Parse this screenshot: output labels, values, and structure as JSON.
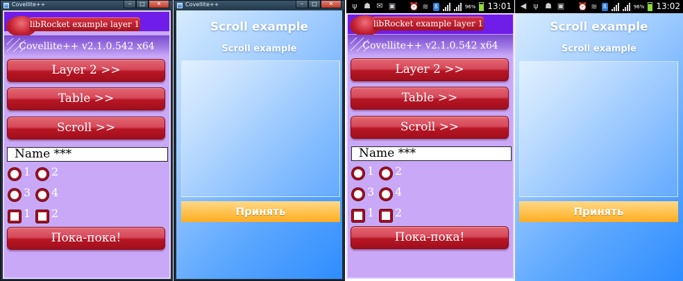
{
  "windows": {
    "title": "Covellite++",
    "controls": {
      "minimize": "–",
      "maximize": "□",
      "close": "✕"
    }
  },
  "android": {
    "screen1": {
      "time": "13:01",
      "battery": "96%"
    },
    "screen2": {
      "time": "13:02",
      "battery": "96%"
    }
  },
  "layer1": {
    "title": "libRocket example layer 1",
    "version": "Covellite++ v2.1.0.542 x64",
    "buttons": {
      "layer2": "Layer 2 >>",
      "table": "Table >>",
      "scroll": "Scroll >>",
      "bye": "Пока-пока!"
    },
    "name_field": "Name ***",
    "radio_labels": [
      "1",
      "2",
      "3",
      "4"
    ],
    "checkbox_labels": [
      "1",
      "2"
    ]
  },
  "scroll": {
    "title": "Scroll example",
    "subtitle": "Scroll example",
    "accept": "Принять"
  },
  "colors": {
    "layer_bg": "#c8a8f7",
    "top_band": "#6f1de8",
    "red_button": "#b81625",
    "scroll_bg": "#5aa6ff",
    "accept_btn": "#ffc352"
  }
}
